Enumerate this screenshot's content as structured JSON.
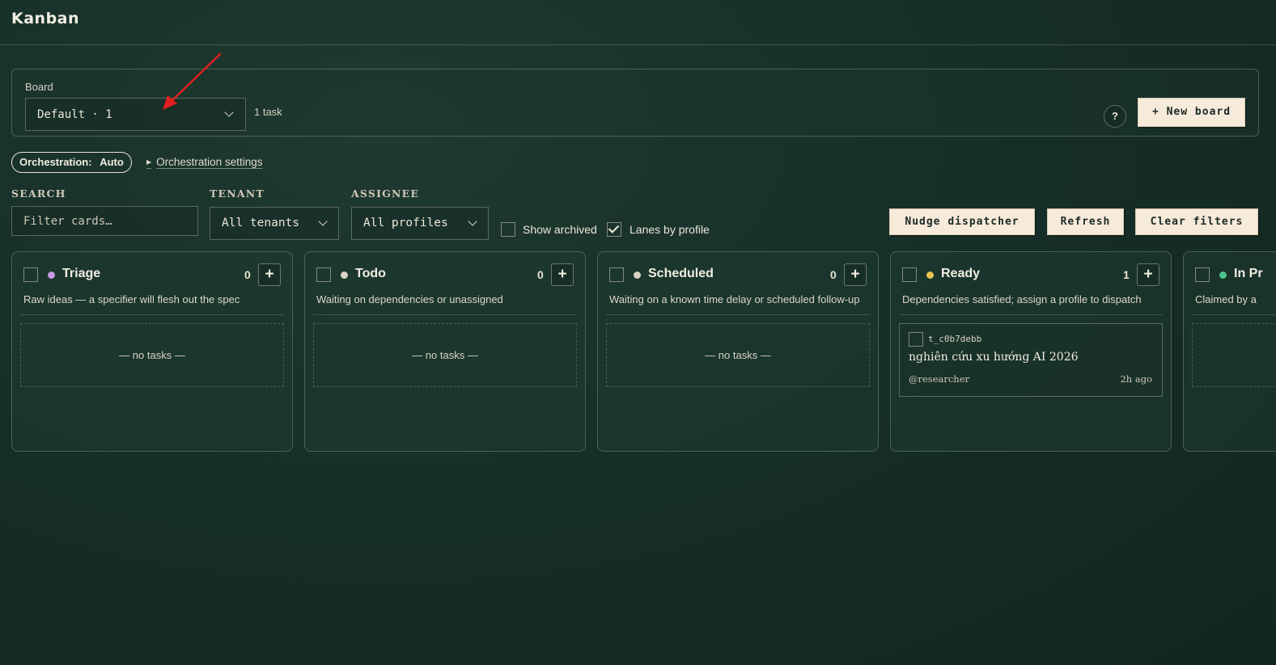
{
  "header": {
    "title": "Kanban"
  },
  "board": {
    "label": "Board",
    "selected": "Default · 1",
    "task_count": "1 task",
    "help_label": "?",
    "new_board_label": "+ New board"
  },
  "orchestration": {
    "pill_label": "Orchestration:",
    "pill_value": "Auto",
    "settings_label": "Orchestration settings"
  },
  "filters": {
    "search_label": "SEARCH",
    "search_placeholder": "Filter cards…",
    "tenant_label": "TENANT",
    "tenant_value": "All tenants",
    "assignee_label": "ASSIGNEE",
    "assignee_value": "All profiles",
    "show_archived_label": "Show archived",
    "show_archived_checked": false,
    "lanes_by_profile_label": "Lanes by profile",
    "lanes_by_profile_checked": true
  },
  "actions": {
    "nudge_label": "Nudge dispatcher",
    "refresh_label": "Refresh",
    "clear_label": "Clear filters"
  },
  "colors": {
    "triage": "#c59ae0",
    "todo": "#d8d2c4",
    "scheduled": "#d8d2c4",
    "ready": "#e5c14d",
    "in_progress": "#4cc48a"
  },
  "columns": [
    {
      "title": "Triage",
      "count": "0",
      "add": "+",
      "desc": "Raw ideas — a specifier will flesh out the spec",
      "empty": "— no tasks —"
    },
    {
      "title": "Todo",
      "count": "0",
      "add": "+",
      "desc": "Waiting on dependencies or unassigned",
      "empty": "— no tasks —"
    },
    {
      "title": "Scheduled",
      "count": "0",
      "add": "+",
      "desc": "Waiting on a known time delay or scheduled follow-up",
      "empty": "— no tasks —"
    },
    {
      "title": "Ready",
      "count": "1",
      "add": "+",
      "desc": "Dependencies satisfied; assign a profile to dispatch",
      "cards": [
        {
          "id": "t_c0b7debb",
          "title": "nghiên cứu xu hướng AI 2026",
          "assignee": "@researcher",
          "time": "2h ago"
        }
      ]
    },
    {
      "title": "In Pr",
      "desc": "Claimed by a"
    }
  ]
}
